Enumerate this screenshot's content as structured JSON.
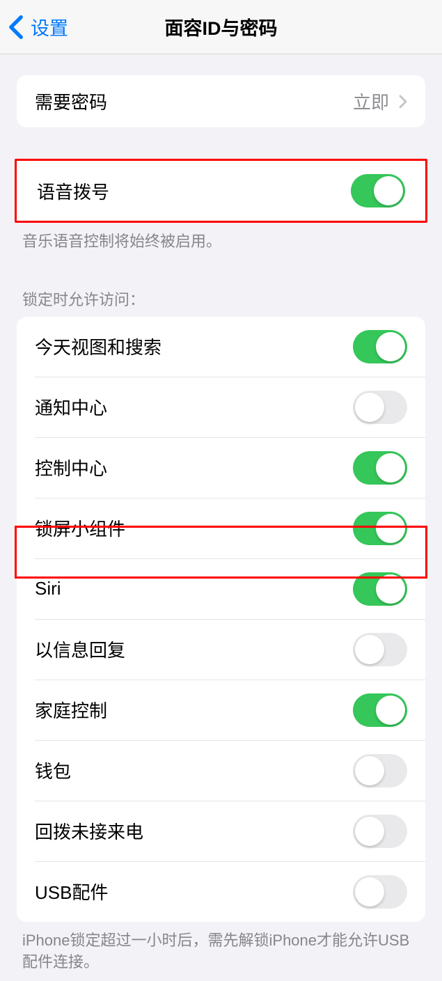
{
  "header": {
    "back_label": "设置",
    "title": "面容ID与密码"
  },
  "passcode_row": {
    "label": "需要密码",
    "value": "立即"
  },
  "voice_dial": {
    "label": "语音拨号",
    "on": true,
    "footer": "音乐语音控制将始终被启用。"
  },
  "lock_section": {
    "header": "锁定时允许访问：",
    "items": [
      {
        "label": "今天视图和搜索",
        "on": true
      },
      {
        "label": "通知中心",
        "on": false
      },
      {
        "label": "控制中心",
        "on": true
      },
      {
        "label": "锁屏小组件",
        "on": true
      },
      {
        "label": "Siri",
        "on": true
      },
      {
        "label": "以信息回复",
        "on": false
      },
      {
        "label": "家庭控制",
        "on": true
      },
      {
        "label": "钱包",
        "on": false
      },
      {
        "label": "回拨未接来电",
        "on": false
      },
      {
        "label": "USB配件",
        "on": false
      }
    ],
    "footer": "iPhone锁定超过一小时后，需先解锁iPhone才能允许USB配件连接。"
  }
}
